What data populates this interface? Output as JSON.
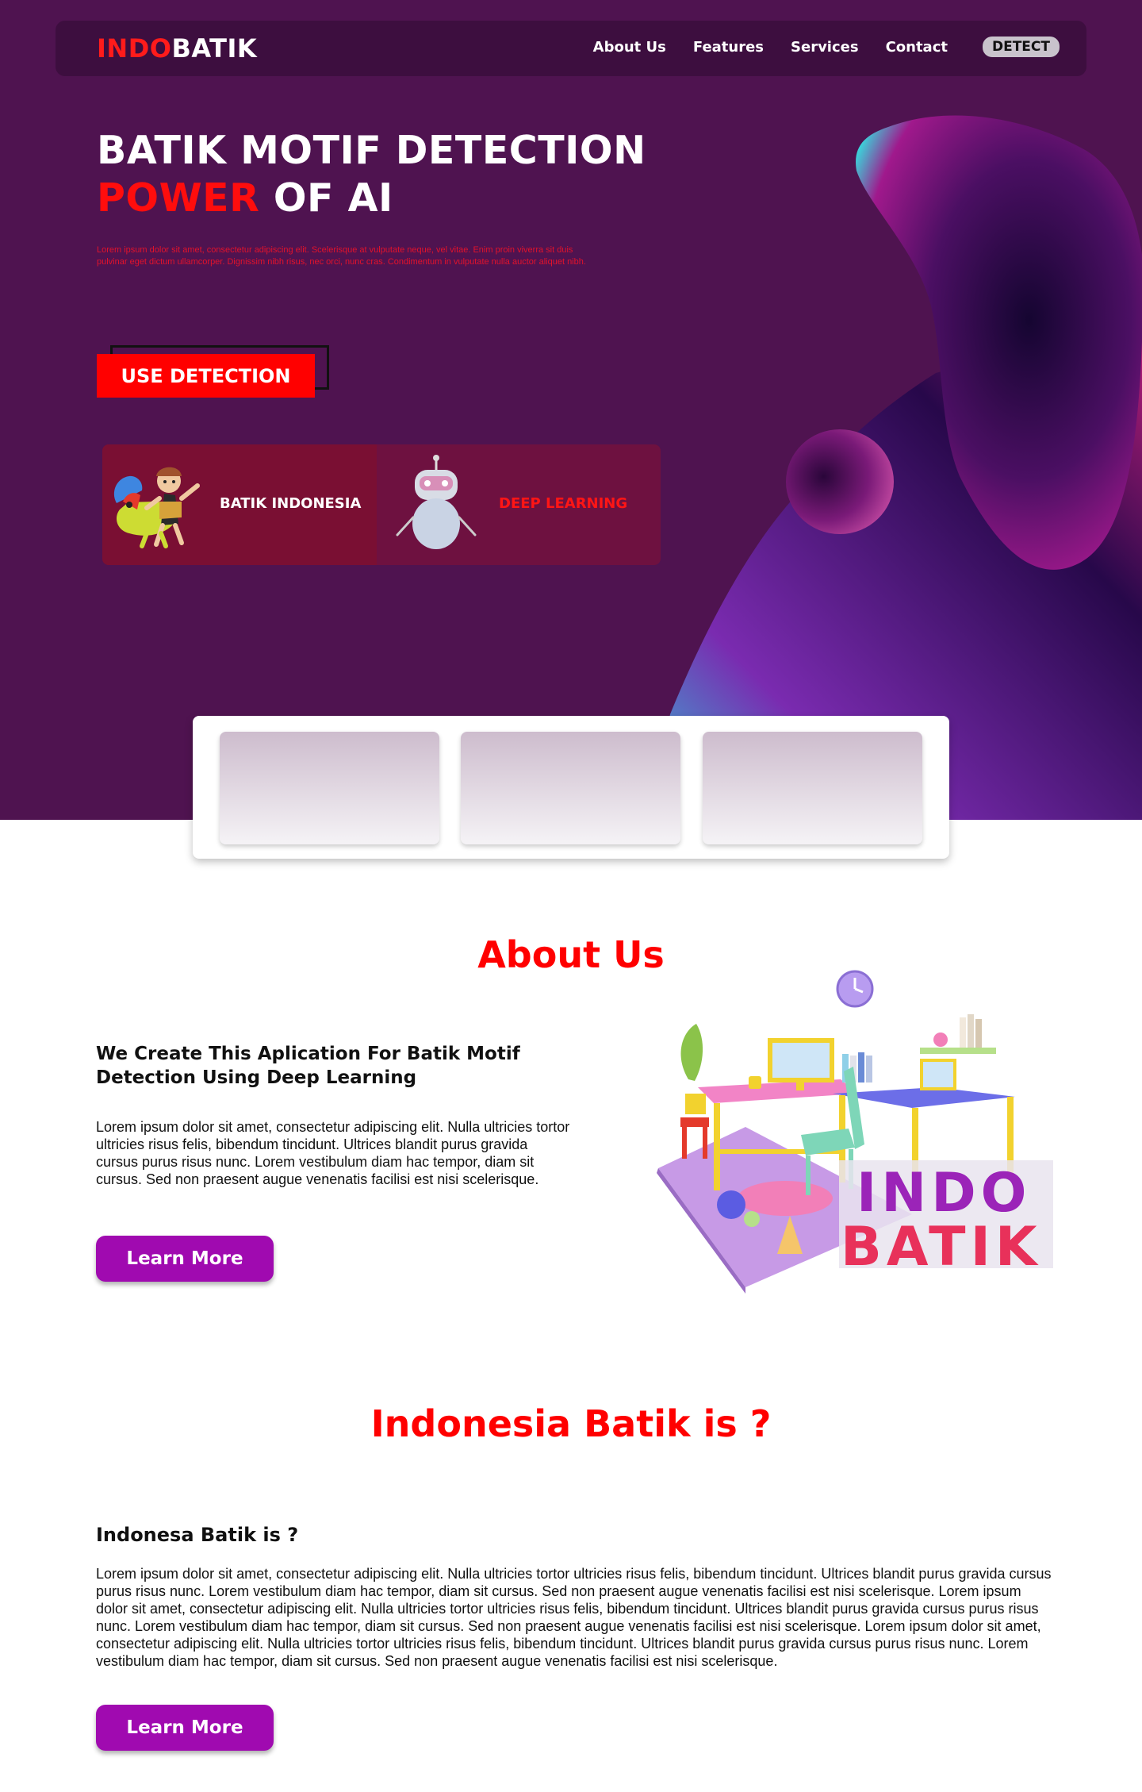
{
  "nav": {
    "logo_part1": "INDO",
    "logo_part2": "BATIK",
    "links": [
      "About Us",
      "Features",
      "Services",
      "Contact"
    ],
    "detect_label": "DETECT"
  },
  "hero": {
    "title_line1": "BATIK MOTIF DETECTION",
    "title_red": "POWER",
    "title_rest": " OF AI",
    "description": "Lorem ipsum dolor sit amet, consectetur adipiscing elit. Scelerisque at vulputate neque, vel vitae. Enim proin viverra sit duis pulvinar eget dictum ullamcorper. Dignissim nibh risus, nec orci, nunc cras. Condimentum in vulputate nulla auctor aliquet nibh.",
    "cta_label": "USE DETECTION",
    "features": [
      {
        "label": "BATIK INDONESIA",
        "icon": "batik-character-icon"
      },
      {
        "label": "DEEP LEARNING",
        "icon": "robot-icon"
      }
    ]
  },
  "about": {
    "heading": "About Us",
    "subheading": "We Create This Aplication For Batik Motif Detection Using Deep Learning",
    "body": "Lorem ipsum dolor sit amet, consectetur adipiscing elit. Nulla ultricies tortor ultricies risus felis, bibendum tincidunt. Ultrices blandit purus gravida cursus purus risus nunc. Lorem vestibulum diam hac tempor, diam sit cursus. Sed non praesent augue venenatis facilisi est nisi scelerisque.",
    "button_label": "Learn More",
    "illustration_text_1": "INDO",
    "illustration_text_2": "BATIK"
  },
  "indonesia": {
    "heading": "Indonesia Batik is ?",
    "subheading": "Indonesa Batik is ?",
    "body": "Lorem ipsum dolor sit amet, consectetur adipiscing elit. Nulla ultricies tortor ultricies risus felis, bibendum tincidunt. Ultrices blandit purus gravida cursus purus risus nunc. Lorem vestibulum diam hac tempor, diam sit cursus. Sed non praesent augue venenatis facilisi est nisi scelerisque. Lorem ipsum dolor sit amet, consectetur adipiscing elit. Nulla ultricies tortor ultricies risus felis, bibendum tincidunt. Ultrices blandit purus gravida cursus purus risus nunc. Lorem vestibulum diam hac tempor, diam sit cursus. Sed non praesent augue venenatis facilisi est nisi scelerisque. Lorem ipsum dolor sit amet, consectetur adipiscing elit. Nulla ultricies tortor ultricies risus felis, bibendum tincidunt. Ultrices blandit purus gravida cursus purus risus nunc. Lorem vestibulum diam hac tempor, diam sit cursus. Sed non praesent augue venenatis facilisi est nisi scelerisque.",
    "button_label": "Learn More"
  },
  "colors": {
    "hero_bg": "#4f1350",
    "accent_red": "#ff0000",
    "button_purple": "#a00ab0"
  }
}
